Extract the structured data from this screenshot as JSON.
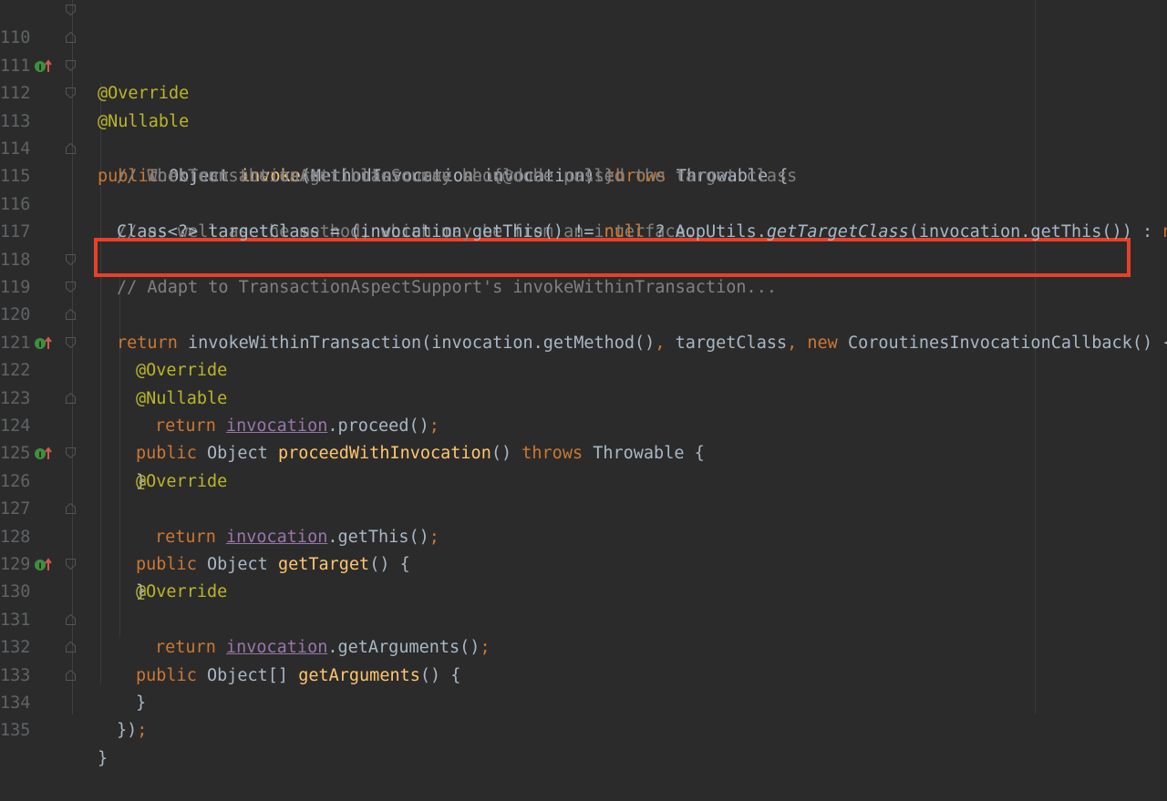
{
  "editor": {
    "colors": {
      "background": "#2b2b2b",
      "keyword": "#cc7832",
      "annotation": "#bbb529",
      "comment": "#808080",
      "method": "#ffc66d",
      "field": "#9876aa",
      "text": "#a9b7c6",
      "line_number": "#606366",
      "highlight_border": "#e8402a"
    },
    "gutter_icons": {
      "override": "override-method-icon",
      "fold": "fold-marker-icon"
    },
    "line_numbers": [
      "110",
      "111",
      "112",
      "113",
      "114",
      "115",
      "116",
      "117",
      "118",
      "119",
      "120",
      "121",
      "122",
      "123",
      "124",
      "125",
      "126",
      "127",
      "128",
      "129",
      "130",
      "131",
      "132",
      "133",
      "134",
      "135"
    ],
    "highlighted_line": "119",
    "lines": {
      "l110": {
        "ann": "@Override"
      },
      "l111": {
        "ann": "@Nullable"
      },
      "l112": {
        "kw_public": "public",
        "type": " Object ",
        "fn": "invoke",
        "params": "(MethodInvocation invocation) ",
        "kw_throws": "throws",
        "rest": " Throwable {"
      },
      "l113": {
        "comment": "// Work out the target class: may be {@code null}."
      },
      "l114": {
        "comment": "// The TransactionAttributeSource should be passed the target class"
      },
      "l115": {
        "comment": "// as well as the method, which may be from an interface."
      },
      "l116": {
        "a": "Class<?> targetClass = (invocation.getThis() != ",
        "null1": "null",
        "b": " ? AopUtils.",
        "getTargetClass": "getTargetClass",
        "c": "(invocation.getThis()) : ",
        "null2": "null",
        "semi": ");"
      },
      "l118": {
        "comment": "// Adapt to TransactionAspectSupport's invokeWithinTransaction..."
      },
      "l119": {
        "kw_return": "return",
        "a": " invokeWithinTransaction(invocation.getMethod()",
        "comma1": ",",
        "b": " targetClass",
        "comma2": ",",
        "kw_new": " new",
        "c": " CoroutinesInvocationCallback() {"
      },
      "l120": {
        "ann": "@Override"
      },
      "l121": {
        "ann": "@Nullable"
      },
      "l122": {
        "kw_public": "public",
        "type": " Object ",
        "fn": "proceedWithInvocation",
        "paren": "() ",
        "kw_throws": "throws",
        "rest": " Throwable {"
      },
      "l123": {
        "kw_return": "return",
        "field": "invocation",
        "rest": ".proceed()",
        "semi": ";"
      },
      "l124": {
        "brace": "}"
      },
      "l125": {
        "ann": "@Override"
      },
      "l126": {
        "kw_public": "public",
        "type": " Object ",
        "fn": "getTarget",
        "rest": "() {"
      },
      "l127": {
        "kw_return": "return",
        "field": "invocation",
        "rest": ".getThis()",
        "semi": ";"
      },
      "l128": {
        "brace": "}"
      },
      "l129": {
        "ann": "@Override"
      },
      "l130": {
        "kw_public": "public",
        "type": " Object[] ",
        "fn": "getArguments",
        "rest": "() {"
      },
      "l131": {
        "kw_return": "return",
        "field": "invocation",
        "rest": ".getArguments()",
        "semi": ";"
      },
      "l132": {
        "brace": "}"
      },
      "l133": {
        "rest": "})",
        "semi": ";"
      },
      "l134": {
        "brace": "}"
      }
    }
  }
}
